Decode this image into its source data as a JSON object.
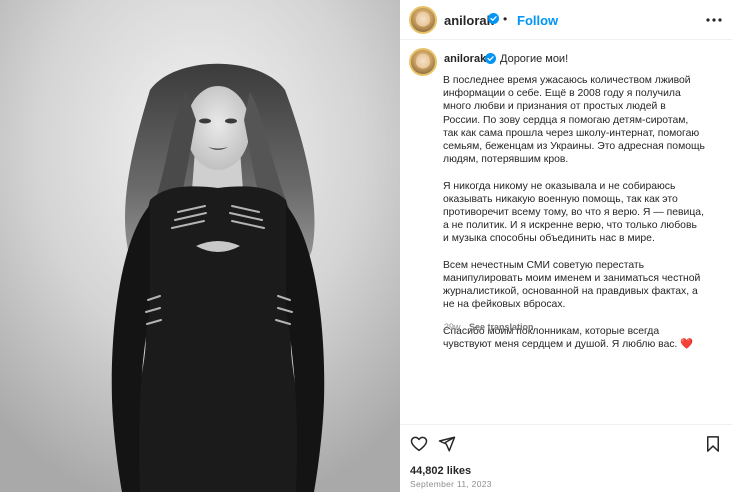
{
  "post": {
    "username": "anilorak",
    "follow_label": "Follow",
    "dot": "•"
  },
  "caption": {
    "username": "anilorak",
    "first_line": "Дорогие мои!",
    "paragraphs": [
      "В последнее время ужасаюсь количеством лживой информации о себе. Ещё в 2008 году я получила много любви и признания от простых людей в России. По зову сердца я помогаю детям-сиротам, так как сама прошла через школу-интернат, помогаю семьям, беженцам из Украины. Это адресная помощь людям, потерявшим кров.",
      "Я никогда никому не оказывала и не собираюсь оказывать никакую военную помощь, так как это противоречит всему тому, во что я верю. Я — певица, а не политик. И я искренне верю, что только любовь и музыка способны объединить нас в мире.",
      "Всем нечестным СМИ советую перестать манипулировать моим именем и заниматься честной журналистикой, основанной на правдивых фактах, а не на фейковых вбросах.",
      "Спасибо моим поклонникам, которые всегда чувствуют меня сердцем и душой. Я люблю вас."
    ],
    "heart_emoji": "❤️",
    "age": "39w",
    "see_translation": "See translation"
  },
  "footer": {
    "likes": "44,802 likes",
    "date": "September 11, 2023"
  },
  "icons": {
    "more": "more-options-icon",
    "like": "heart-icon",
    "share": "share-icon",
    "save": "bookmark-icon",
    "verified": "verified-badge-icon"
  },
  "colors": {
    "link": "#0095f6",
    "verified": "#0095f6",
    "muted": "#8e8e8e",
    "heart": "#ed4956"
  }
}
